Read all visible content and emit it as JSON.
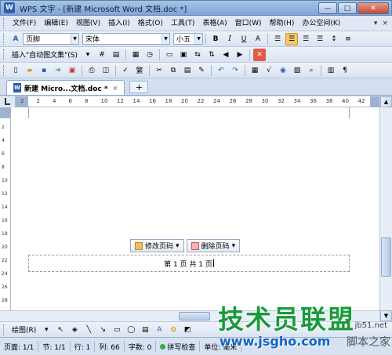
{
  "window": {
    "app_icon": "W",
    "title": "WPS 文字 - [新建 Microsoft Word 文档.doc *]",
    "minimize": "—",
    "maximize": "□",
    "close": "✕"
  },
  "menu": {
    "items": [
      "文件(F)",
      "编辑(E)",
      "视图(V)",
      "插入(I)",
      "格式(O)",
      "工具(T)",
      "表格(A)",
      "窗口(W)",
      "帮助(H)",
      "办公空间(K)"
    ],
    "tail": [
      "▾",
      "×"
    ]
  },
  "format_toolbar": {
    "style_value": "页脚",
    "font_value": "宋体",
    "size_value": "小五",
    "bold": "B",
    "italic": "I",
    "underline": "U",
    "font_color": "A"
  },
  "autotext_toolbar": {
    "insert_label": "插入\"自动图文集\"(S)"
  },
  "document_tab": {
    "label": "新建 Micro...文档.doc *",
    "close": "×",
    "new_tab": "+"
  },
  "ruler": {
    "ticks": [
      "2",
      "2",
      "4",
      "6",
      "8",
      "10",
      "12",
      "14",
      "16",
      "18",
      "20",
      "22",
      "24",
      "26",
      "28",
      "30",
      "32",
      "34",
      "36",
      "38",
      "40",
      "42"
    ]
  },
  "vruler": {
    "ticks": [
      "2",
      "4",
      "6",
      "8",
      "10",
      "12",
      "14",
      "16",
      "18",
      "20",
      "22",
      "24",
      "26",
      "28",
      "30"
    ]
  },
  "footer": {
    "edit_page_number": "修改页码",
    "delete_page_number": "删除页码",
    "text": "第 1 页 共 1 页"
  },
  "drawing_toolbar": {
    "draw_label": "绘图(R)"
  },
  "status": {
    "page": "页面: 1/1",
    "section": "节: 1/1",
    "line": "行: 1",
    "column": "列: 66",
    "chars": "字数: 0",
    "spell": "拼写检查",
    "unit": "单位: 毫米"
  },
  "watermark": {
    "main": "技术员联盟",
    "url": "www.jsgho.com",
    "side": "脚本之家",
    "corner": "jb51.net"
  }
}
